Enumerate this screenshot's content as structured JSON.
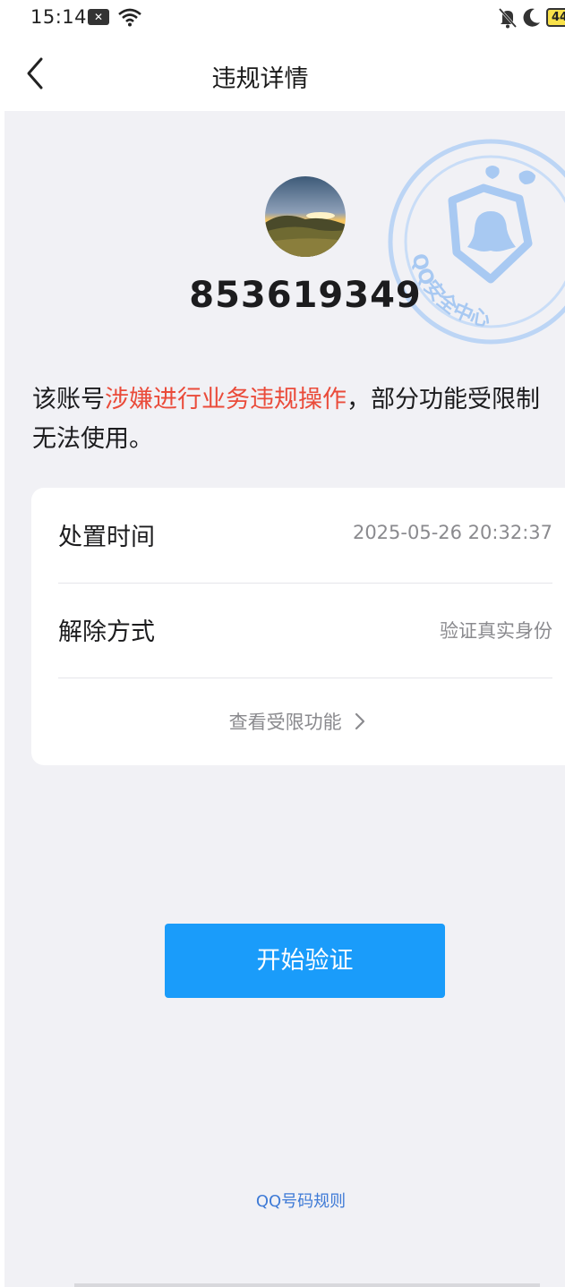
{
  "status_bar": {
    "time": "15:14",
    "battery": "44"
  },
  "header": {
    "title": "违规详情"
  },
  "watermark": {
    "text": "QQ安全中心"
  },
  "account": {
    "number": "853619349"
  },
  "notice": {
    "prefix": "该账号",
    "highlight": "涉嫌进行业务违规操作",
    "suffix": "，部分功能受限制",
    "line2": "无法使用。"
  },
  "details": {
    "rows": [
      {
        "label": "处置时间",
        "value": "2025-05-26 20:32:37"
      },
      {
        "label": "解除方式",
        "value": "验证真实身份"
      }
    ],
    "view_link": "查看受限功能"
  },
  "actions": {
    "verify_label": "开始验证"
  },
  "footer": {
    "rules_link": "QQ号码规则"
  },
  "colors": {
    "accent": "#1a9cfa",
    "highlight": "#ea4b3a",
    "link": "#3e7ad6",
    "background": "#f1f1f5"
  }
}
